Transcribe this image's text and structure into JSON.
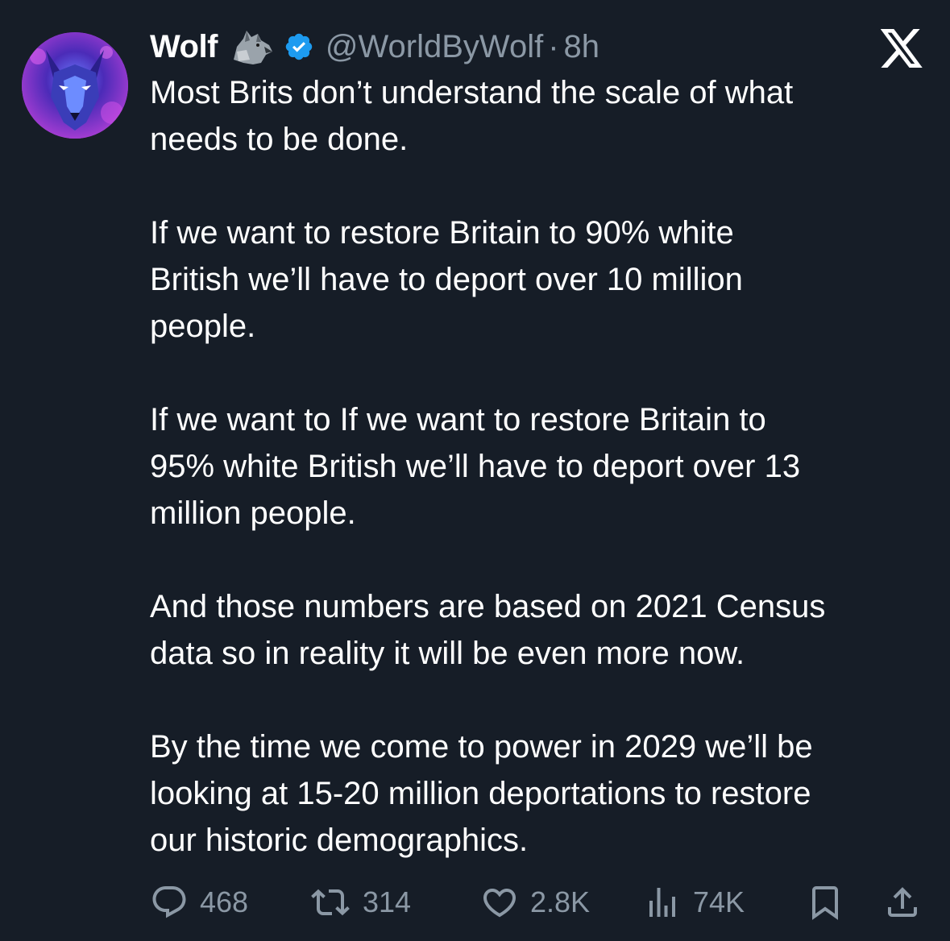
{
  "author": {
    "name": "Wolf",
    "handle": "@WorldByWolf",
    "separator": "·",
    "time": "8h",
    "avatar_icon": "wolf-avatar",
    "name_emoji_icon": "wolf-emoji-icon",
    "verified_icon": "verified-badge-icon",
    "verified_color": "#1d9bf0"
  },
  "platform": {
    "logo_icon": "x-logo-icon"
  },
  "tweet": {
    "paragraphs": [
      "Most Brits don’t understand the scale of what\nneeds to be done.",
      "If we want to restore Britain to 90% white\nBritish we’ll have to deport over 10 million\npeople.",
      "If we want to If we want to restore Britain to\n95% white British we’ll have to deport over 13\nmillion people.",
      "And those numbers are based on 2021 Census\ndata so in reality it will be even more now.",
      "By the time we come to power in 2029 we’ll be\nlooking at 15-20 million deportations to restore\nour historic demographics."
    ]
  },
  "actions": {
    "replies": "468",
    "reposts": "314",
    "likes": "2.8K",
    "views": "74K"
  },
  "colors": {
    "background": "#161d27",
    "text": "#ffffff",
    "muted": "#8b98a5",
    "accent": "#1d9bf0"
  }
}
